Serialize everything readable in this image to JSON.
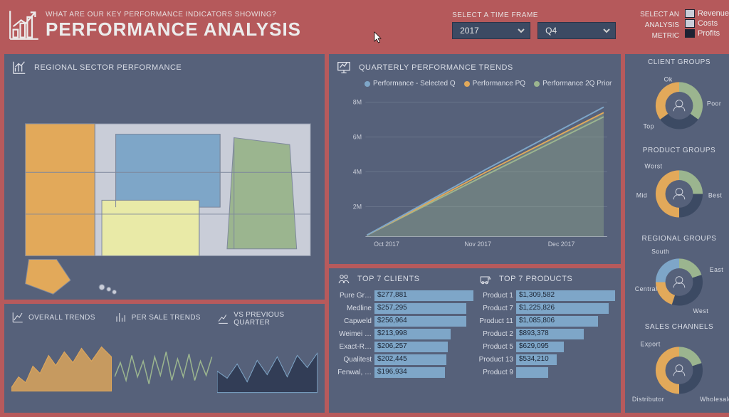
{
  "header": {
    "subtitle": "WHAT ARE OUR KEY PERFORMANCE INDICATORS SHOWING?",
    "title": "PERFORMANCE ANALYSIS",
    "timeframe_label": "SELECT A TIME FRAME",
    "year_selected": "2017",
    "quarter_selected": "Q4",
    "metric_caption_line1": "SELECT AN",
    "metric_caption_line2": "ANALYSIS",
    "metric_caption_line3": "METRIC",
    "metrics": [
      {
        "label": "Revenue",
        "color": "#c9cdd8"
      },
      {
        "label": "Costs",
        "color": "#c9cdd8"
      },
      {
        "label": "Profits",
        "color": "#1d2233"
      }
    ]
  },
  "panels": {
    "regional": {
      "title": "REGIONAL SECTOR PERFORMANCE"
    },
    "trends_overall": {
      "title": "OVERALL TRENDS"
    },
    "trends_persale": {
      "title": "PER SALE TRENDS"
    },
    "trends_vsprev": {
      "title": "VS PREVIOUS QUARTER"
    },
    "quarterly": {
      "title": "QUARTERLY PERFORMANCE TRENDS",
      "legend": [
        "Performance - Selected Q",
        "Performance PQ",
        "Performance 2Q Prior"
      ]
    },
    "top_clients": {
      "title": "TOP 7 CLIENTS"
    },
    "top_products": {
      "title": "TOP 7 PRODUCTS"
    },
    "client_groups": {
      "title": "CLIENT GROUPS",
      "labels": [
        "Ok",
        "Poor",
        "Top"
      ]
    },
    "product_groups": {
      "title": "PRODUCT GROUPS",
      "labels": [
        "Worst",
        "Mid",
        "Best"
      ]
    },
    "regional_groups": {
      "title": "REGIONAL GROUPS",
      "labels": [
        "South",
        "East",
        "Central",
        "West"
      ]
    },
    "sales_channels": {
      "title": "SALES CHANNELS",
      "labels": [
        "Export",
        "Distributor",
        "Wholesale"
      ]
    }
  },
  "colors": {
    "series1": "#7ea6c8",
    "series2": "#e2a95a",
    "series3": "#9bb58f",
    "donut_a": "#9bb58f",
    "donut_b": "#3c4a63",
    "donut_c": "#e2a95a",
    "donut_d": "#7ea6c8",
    "map_a": "#7ea6c8",
    "map_b": "#e2a95a",
    "map_c": "#e9eaa7",
    "map_d": "#9bb58f",
    "map_blank": "#c9cdd8"
  },
  "chart_data": [
    {
      "id": "quarterly_performance",
      "type": "line",
      "title": "Quarterly Performance Trends",
      "x": [
        "Oct 2017",
        "Nov 2017",
        "Dec 2017"
      ],
      "ylim": [
        0,
        8000000
      ],
      "yticks": [
        "2M",
        "4M",
        "6M",
        "8M"
      ],
      "series": [
        {
          "name": "Performance - Selected Q",
          "color": "#7ea6c8",
          "values": [
            200000,
            3700000,
            7400000
          ]
        },
        {
          "name": "Performance PQ",
          "color": "#e2a95a",
          "values": [
            200000,
            3500000,
            7100000
          ]
        },
        {
          "name": "Performance 2Q Prior",
          "color": "#9bb58f",
          "values": [
            200000,
            3400000,
            6900000
          ]
        }
      ]
    },
    {
      "id": "top7_clients",
      "type": "bar",
      "title": "Top 7 Clients",
      "orientation": "horizontal",
      "categories": [
        "Pure Gr…",
        "Medline",
        "Capweld",
        "Weimei …",
        "Exact-R…",
        "Qualitest",
        "Fenwal, …"
      ],
      "values": [
        277881,
        257295,
        256964,
        213998,
        206257,
        202445,
        196934
      ],
      "value_labels": [
        "$277,881",
        "$257,295",
        "$256,964",
        "$213,998",
        "$206,257",
        "$202,445",
        "$196,934"
      ]
    },
    {
      "id": "top7_products",
      "type": "bar",
      "title": "Top 7 Products",
      "orientation": "horizontal",
      "categories": [
        "Product 1",
        "Product 7",
        "Product 11",
        "Product 2",
        "Product 5",
        "Product 13",
        "Product 9"
      ],
      "values": [
        1309582,
        1225826,
        1085806,
        893378,
        629095,
        534210,
        420000
      ],
      "value_labels": [
        "$1,309,582",
        "$1,225,826",
        "$1,085,806",
        "$893,378",
        "$629,095",
        "$534,210",
        ""
      ]
    },
    {
      "id": "client_groups_donut",
      "type": "pie",
      "categories": [
        "Ok",
        "Poor",
        "Top"
      ],
      "values": [
        35,
        30,
        35
      ]
    },
    {
      "id": "product_groups_donut",
      "type": "pie",
      "categories": [
        "Worst",
        "Mid",
        "Best"
      ],
      "values": [
        25,
        25,
        50
      ]
    },
    {
      "id": "regional_groups_donut",
      "type": "pie",
      "categories": [
        "South",
        "East",
        "Central",
        "West"
      ],
      "values": [
        20,
        35,
        20,
        25
      ]
    },
    {
      "id": "sales_channels_donut",
      "type": "pie",
      "categories": [
        "Export",
        "Distributor",
        "Wholesale"
      ],
      "values": [
        20,
        30,
        50
      ]
    }
  ]
}
